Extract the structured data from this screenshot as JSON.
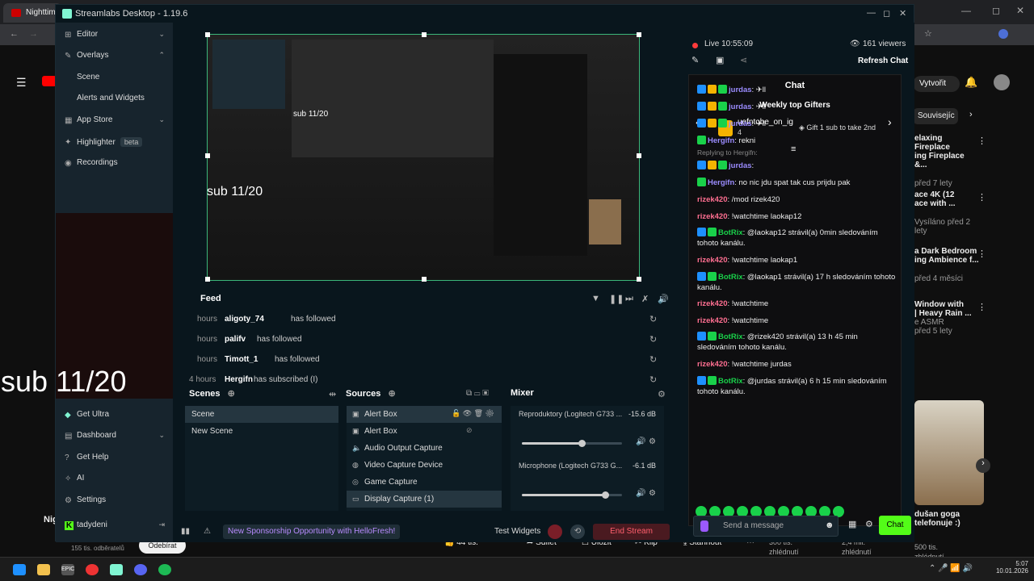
{
  "browser": {
    "tab_title": "Nighttime",
    "yt_header": {
      "create_label": "Vytvořit"
    },
    "chip": "Souvisejíc",
    "recommended": [
      {
        "title1": "elaxing Fireplace",
        "title2": "ing Fireplace &...",
        "meta": "před 7 lety"
      },
      {
        "title1": "ace 4K (12",
        "title2": "ace with ...",
        "meta": "Vysíláno před 2 lety"
      },
      {
        "title1": "a Dark Bedroom",
        "title2": "ing Ambience f...",
        "meta": "před 4 měsíci"
      },
      {
        "title1": "Window with",
        "title2": "| Heavy Rain ...",
        "meta": "e ASMR",
        "meta2": "před 5 lety"
      }
    ],
    "video_card": {
      "title1": "dušan goga",
      "title2": "telefonuje :)"
    },
    "channel": {
      "name": "Nig",
      "subs": "155 tis. odběratelů",
      "unsub_label": "Odebírat"
    },
    "actions": {
      "likes": "44 tis.",
      "share": "Sdílet",
      "save": "Uložit",
      "clip": "Klip",
      "download": "Stáhnout"
    },
    "stats": [
      {
        "value": "300 tis.",
        "label": "zhlédnutí"
      },
      {
        "value": "2,4 mil.",
        "label": "zhlédnutí"
      },
      {
        "value": "500 tis.",
        "label": "zhlédnutí"
      }
    ]
  },
  "app": {
    "title": "Streamlabs Desktop - 1.19.6"
  },
  "sidebar": {
    "items": [
      {
        "label": "Editor",
        "chevron": "⌄"
      },
      {
        "label": "Overlays",
        "chevron": "⌃"
      },
      {
        "label": "Scene"
      },
      {
        "label": "Alerts and Widgets"
      },
      {
        "label": "App Store",
        "chevron": "⌄"
      },
      {
        "label": "Highlighter",
        "badge": "beta"
      },
      {
        "label": "Recordings"
      }
    ],
    "bottom": [
      {
        "label": "Get Ultra"
      },
      {
        "label": "Dashboard",
        "chevron": "⌄"
      },
      {
        "label": "Get Help"
      },
      {
        "label": "AI"
      },
      {
        "label": "Settings"
      },
      {
        "label": "tadydeni"
      }
    ]
  },
  "overlay": {
    "sub_counter": "sub 11/20"
  },
  "feed": {
    "title": "Feed",
    "rows": [
      {
        "time": "hours",
        "name": "aligoty_74",
        "action": "has followed"
      },
      {
        "time": "hours",
        "name": "palifv",
        "action": "has followed"
      },
      {
        "time": "hours",
        "name": "Timott_1",
        "action": "has followed"
      },
      {
        "time": "4 hours",
        "name": "Hergifn",
        "action": "has subscribed (I)"
      }
    ]
  },
  "scenes": {
    "title": "Scenes",
    "items": [
      "Scene",
      "New Scene"
    ]
  },
  "sources": {
    "title": "Sources",
    "items": [
      "Alert Box",
      "Alert Box",
      "Audio Output Capture",
      "Video Capture Device",
      "Game Capture",
      "Display Capture (1)"
    ]
  },
  "mixer": {
    "title": "Mixer",
    "channels": [
      {
        "name": "Reproduktory (Logitech G733 ...",
        "db": "-15.6 dB",
        "level": 0.6
      },
      {
        "name": "Microphone (Logitech G733 G...",
        "db": "-6.1 dB",
        "level": 0.83
      }
    ]
  },
  "footer": {
    "sponsor": "New Sponsorship Opportunity with HelloFresh!",
    "test_widgets": "Test Widgets",
    "end_stream": "End Stream"
  },
  "chat": {
    "live_time": "Live 10:55:09",
    "viewers": "161 viewers",
    "refresh": "Refresh Chat",
    "title": "Chat",
    "gifters_title": "Weekly top Gifters",
    "gifter_name": "uefntobe_on_ig",
    "gifter_count": "4",
    "gift_cta": "Gift 1 sub to take 2nd",
    "replying_to": "Replying to Hergifn:",
    "messages": [
      {
        "nick": "jurdas",
        "text": ": ✈ll",
        "color": "#9b8cff"
      },
      {
        "nick": "jurdas",
        "text": ": ✈ll",
        "color": "#9b8cff"
      },
      {
        "nick": "jurdas",
        "text": ": ✈ll",
        "color": "#9b8cff"
      },
      {
        "nick": "Hergifn",
        "text": ": rekni",
        "color": "#9b8cff"
      },
      {
        "nick": "jurdas",
        "text": ":",
        "color": "#9b8cff"
      },
      {
        "nick": "Hergifn",
        "text": ": no nic jdu spat tak cus prijdu pak",
        "color": "#9b8cff"
      },
      {
        "nick": "rizek420",
        "text": ": /mod rizek420",
        "color": "#ff6f91"
      },
      {
        "nick": "rizek420",
        "text": ": !watchtime laokap12",
        "color": "#ff6f91"
      },
      {
        "nick": "BotRix",
        "text": ": @laokap12 strávil(a) 0min sledováním tohoto kanálu.",
        "color": "#19d14a"
      },
      {
        "nick": "rizek420",
        "text": ": !watchtime laokap1",
        "color": "#ff6f91"
      },
      {
        "nick": "BotRix",
        "text": ": @laokap1 strávil(a) 17 h sledováním tohoto kanálu.",
        "color": "#19d14a"
      },
      {
        "nick": "rizek420",
        "text": ": !watchtime",
        "color": "#ff6f91"
      },
      {
        "nick": "rizek420",
        "text": ": !watchtime",
        "color": "#ff6f91"
      },
      {
        "nick": "BotRix",
        "text": ": @rizek420 strávil(a) 13 h 45 min sledováním tohoto kanálu.",
        "color": "#19d14a"
      },
      {
        "nick": "rizek420",
        "text": ": !watchtime jurdas",
        "color": "#ff6f91"
      },
      {
        "nick": "BotRix",
        "text": ": @jurdas strávil(a) 6 h 15 min sledováním tohoto kanálu.",
        "color": "#19d14a"
      }
    ],
    "input_placeholder": "Send a message",
    "send_label": "Chat"
  },
  "taskbar": {
    "time": "5:07",
    "date": "10.01.2026"
  }
}
